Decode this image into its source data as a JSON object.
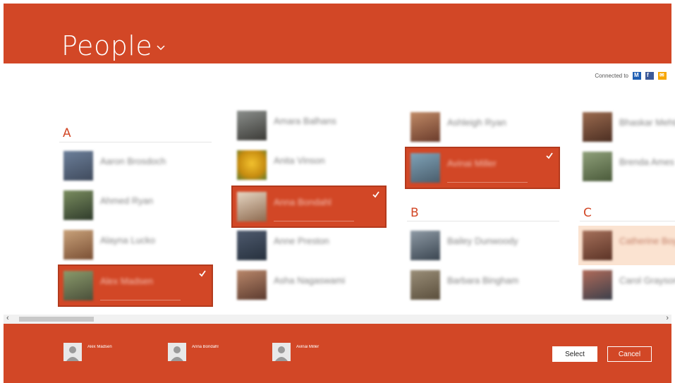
{
  "header": {
    "title": "People"
  },
  "connected": {
    "label": "Connected to",
    "services": [
      "microsoft-icon",
      "facebook-icon",
      "mail-icon"
    ]
  },
  "groups": [
    {
      "letter": "A"
    },
    {
      "letter": "B"
    },
    {
      "letter": "C"
    }
  ],
  "people": [
    {
      "name": "Aaron Brosdoch",
      "selected": false
    },
    {
      "name": "Ahmed Ryan",
      "selected": false
    },
    {
      "name": "Alayna Lucko",
      "selected": false
    },
    {
      "name": "Alex Madsen",
      "selected": true
    },
    {
      "name": "Amara Balhans",
      "selected": false
    },
    {
      "name": "Anita Vinson",
      "selected": false
    },
    {
      "name": "Anna Bondahl",
      "selected": true
    },
    {
      "name": "Anne Preston",
      "selected": false
    },
    {
      "name": "Asha Nagaswami",
      "selected": false
    },
    {
      "name": "Ashleigh Ryan",
      "selected": false
    },
    {
      "name": "Avinai Miller",
      "selected": true
    },
    {
      "name": "Bailey Dunwoody",
      "selected": false
    },
    {
      "name": "Barbara Bingham",
      "selected": false
    },
    {
      "name": "Bhaskar Mehta",
      "selected": false
    },
    {
      "name": "Brenda Ames",
      "selected": false
    },
    {
      "name": "Catherine Boyle",
      "selected": false
    },
    {
      "name": "Carol Grayson",
      "selected": false
    }
  ],
  "selection_tray": [
    {
      "name": "Alex Madsen"
    },
    {
      "name": "Anna Bondahl"
    },
    {
      "name": "Avinai Miller"
    }
  ],
  "footer": {
    "select_label": "Select",
    "cancel_label": "Cancel"
  },
  "scroll": {
    "left_arrow": "‹",
    "right_arrow": "›"
  },
  "colors": {
    "accent": "#d24726",
    "hover": "#fbe3d1"
  }
}
